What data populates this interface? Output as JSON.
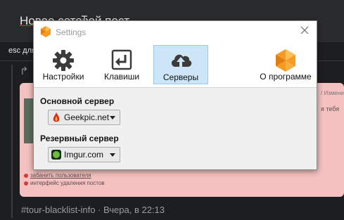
{
  "background": {
    "post_title": "Новое сетевой пост",
    "hint": "esc для",
    "right_text_1": "/ Измени",
    "right_text_2": "я тебя",
    "list_items": [
      "забанить пользователя",
      "интерфейс удаления постов"
    ],
    "footer": "#tour-blacklist-info  · Вчера, в 22:13"
  },
  "dialog": {
    "title": "Settings",
    "toolbar": {
      "items": [
        {
          "label": "Настройки",
          "icon": "gear-icon"
        },
        {
          "label": "Клавиши",
          "icon": "keyboard-enter-icon"
        },
        {
          "label": "Серверы",
          "icon": "cloud-upload-icon",
          "active": true
        },
        {
          "label": "О программе",
          "icon": "app-logo-icon"
        }
      ]
    },
    "primary": {
      "label": "Основной сервер",
      "value": "Geekpic.net",
      "icon": "geekpic-logo-icon"
    },
    "backup": {
      "label": "Резервный сервер",
      "value": "Imgur.com",
      "icon": "imgur-logo-icon"
    }
  },
  "colors": {
    "accent_active": "#cde6f7",
    "app_orange": "#f59a23",
    "card_pink": "#f4c1c0"
  }
}
